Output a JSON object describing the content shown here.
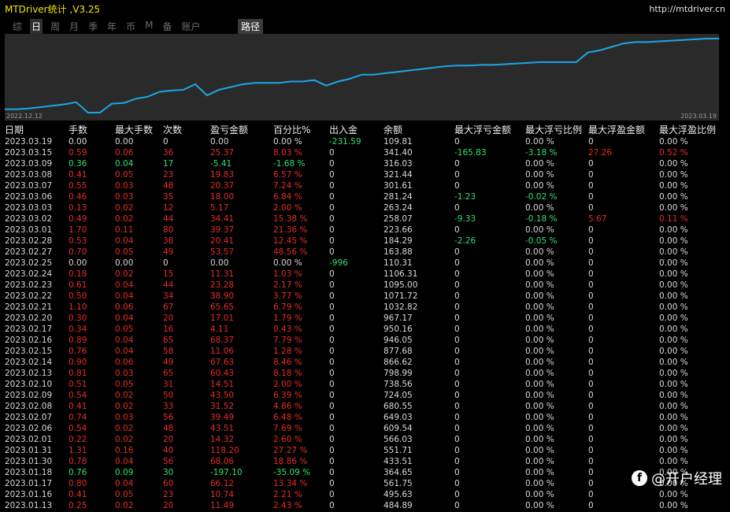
{
  "header": {
    "title": "MTDriver统计 ,V3.25",
    "url": "http://mtdriver.cn"
  },
  "toolbar": {
    "tabs": [
      "综",
      "日",
      "周",
      "月",
      "季",
      "年",
      "币",
      "M",
      "备",
      "账户"
    ],
    "active_index": 1,
    "path_label": "路径"
  },
  "chart_data": {
    "type": "line",
    "x_start_label": "2022.12.12",
    "x_end_label": "2023.03.19",
    "color": "#1aa7e6",
    "values": [
      0.0,
      0.0,
      0.01,
      0.03,
      0.05,
      0.07,
      0.1,
      -0.05,
      -0.05,
      0.08,
      0.09,
      0.15,
      0.18,
      0.25,
      0.27,
      0.28,
      0.36,
      0.2,
      0.28,
      0.32,
      0.36,
      0.38,
      0.38,
      0.38,
      0.4,
      0.4,
      0.42,
      0.34,
      0.4,
      0.44,
      0.5,
      0.5,
      0.52,
      0.54,
      0.56,
      0.58,
      0.6,
      0.62,
      0.63,
      0.63,
      0.64,
      0.64,
      0.65,
      0.66,
      0.67,
      0.68,
      0.68,
      0.68,
      0.68,
      0.82,
      0.85,
      0.9,
      0.95,
      0.97,
      0.97,
      0.98,
      0.99,
      1.0,
      1.01,
      1.02,
      1.02
    ]
  },
  "table": {
    "headers": [
      "日期",
      "手数",
      "最大手数",
      "次数",
      "盈亏金额",
      "百分比%",
      "出入金",
      "余额",
      "最大浮亏金额",
      "最大浮亏比例",
      "最大浮盈金额",
      "最大浮盈比例"
    ],
    "rows": [
      {
        "c": [
          "2023.03.19",
          "0.00",
          "0.00",
          "0",
          "0.00",
          "0.00 %",
          "-231.59",
          "109.81",
          "0",
          "0.00 %",
          "0",
          "0.00 %"
        ],
        "k": [
          "d",
          "n",
          "n",
          "n",
          "n",
          "n",
          "g",
          "n",
          "n",
          "n",
          "n",
          "n"
        ]
      },
      {
        "c": [
          "2023.03.15",
          "0.59",
          "0.06",
          "36",
          "25.37",
          "8.03 %",
          "0",
          "341.40",
          "-165.83",
          "-3.18 %",
          "27.26",
          "0.52 %"
        ],
        "k": [
          "d",
          "r",
          "r",
          "r",
          "r",
          "r",
          "n",
          "n",
          "g",
          "g",
          "r",
          "r"
        ]
      },
      {
        "c": [
          "2023.03.09",
          "0.36",
          "0.04",
          "17",
          "-5.41",
          "-1.68 %",
          "0",
          "316.03",
          "0",
          "0.00 %",
          "0",
          "0.00 %"
        ],
        "k": [
          "d",
          "g",
          "g",
          "g",
          "g",
          "g",
          "n",
          "n",
          "n",
          "n",
          "n",
          "n"
        ]
      },
      {
        "c": [
          "2023.03.08",
          "0.41",
          "0.05",
          "23",
          "19.83",
          "6.57 %",
          "0",
          "321.44",
          "0",
          "0.00 %",
          "0",
          "0.00 %"
        ],
        "k": [
          "d",
          "r",
          "r",
          "r",
          "r",
          "r",
          "n",
          "n",
          "n",
          "n",
          "n",
          "n"
        ]
      },
      {
        "c": [
          "2023.03.07",
          "0.55",
          "0.03",
          "48",
          "20.37",
          "7.24 %",
          "0",
          "301.61",
          "0",
          "0.00 %",
          "0",
          "0.00 %"
        ],
        "k": [
          "d",
          "r",
          "r",
          "r",
          "r",
          "r",
          "n",
          "n",
          "n",
          "n",
          "n",
          "n"
        ]
      },
      {
        "c": [
          "2023.03.06",
          "0.46",
          "0.03",
          "35",
          "18.00",
          "6.84 %",
          "0",
          "281.24",
          "-1.23",
          "-0.02 %",
          "0",
          "0.00 %"
        ],
        "k": [
          "d",
          "r",
          "r",
          "r",
          "r",
          "r",
          "n",
          "n",
          "g",
          "g",
          "n",
          "n"
        ]
      },
      {
        "c": [
          "2023.03.03",
          "0.13",
          "0.02",
          "12",
          "5.17",
          "2.00 %",
          "0",
          "263.24",
          "0",
          "0.00 %",
          "0",
          "0.00 %"
        ],
        "k": [
          "d",
          "r",
          "r",
          "r",
          "r",
          "r",
          "n",
          "n",
          "n",
          "n",
          "n",
          "n"
        ]
      },
      {
        "c": [
          "2023.03.02",
          "0.49",
          "0.02",
          "44",
          "34.41",
          "15.38 %",
          "0",
          "258.07",
          "-9.33",
          "-0.18 %",
          "5.67",
          "0.11 %"
        ],
        "k": [
          "d",
          "r",
          "r",
          "r",
          "r",
          "r",
          "n",
          "n",
          "g",
          "g",
          "r",
          "r"
        ]
      },
      {
        "c": [
          "2023.03.01",
          "1.70",
          "0.11",
          "80",
          "39.37",
          "21.36 %",
          "0",
          "223.66",
          "0",
          "0.00 %",
          "0",
          "0.00 %"
        ],
        "k": [
          "d",
          "r",
          "r",
          "r",
          "r",
          "r",
          "n",
          "n",
          "n",
          "n",
          "n",
          "n"
        ]
      },
      {
        "c": [
          "2023.02.28",
          "0.53",
          "0.04",
          "38",
          "20.41",
          "12.45 %",
          "0",
          "184.29",
          "-2.26",
          "-0.05 %",
          "0",
          "0.00 %"
        ],
        "k": [
          "d",
          "r",
          "r",
          "r",
          "r",
          "r",
          "n",
          "n",
          "g",
          "g",
          "n",
          "n"
        ]
      },
      {
        "c": [
          "2023.02.27",
          "0.70",
          "0.05",
          "49",
          "53.57",
          "48.56 %",
          "0",
          "163.88",
          "0",
          "0.00 %",
          "0",
          "0.00 %"
        ],
        "k": [
          "d",
          "r",
          "r",
          "r",
          "r",
          "r",
          "n",
          "n",
          "n",
          "n",
          "n",
          "n"
        ]
      },
      {
        "c": [
          "2023.02.25",
          "0.00",
          "0.00",
          "0",
          "0.00",
          "0.00 %",
          "-996",
          "110.31",
          "0",
          "0.00 %",
          "0",
          "0.00 %"
        ],
        "k": [
          "d",
          "n",
          "n",
          "n",
          "n",
          "n",
          "g",
          "n",
          "n",
          "n",
          "n",
          "n"
        ]
      },
      {
        "c": [
          "2023.02.24",
          "0.18",
          "0.02",
          "15",
          "11.31",
          "1.03 %",
          "0",
          "1106.31",
          "0",
          "0.00 %",
          "0",
          "0.00 %"
        ],
        "k": [
          "d",
          "r",
          "r",
          "r",
          "r",
          "r",
          "n",
          "n",
          "n",
          "n",
          "n",
          "n"
        ]
      },
      {
        "c": [
          "2023.02.23",
          "0.61",
          "0.04",
          "44",
          "23.28",
          "2.17 %",
          "0",
          "1095.00",
          "0",
          "0.00 %",
          "0",
          "0.00 %"
        ],
        "k": [
          "d",
          "r",
          "r",
          "r",
          "r",
          "r",
          "n",
          "n",
          "n",
          "n",
          "n",
          "n"
        ]
      },
      {
        "c": [
          "2023.02.22",
          "0.50",
          "0.04",
          "34",
          "38.90",
          "3.77 %",
          "0",
          "1071.72",
          "0",
          "0.00 %",
          "0",
          "0.00 %"
        ],
        "k": [
          "d",
          "r",
          "r",
          "r",
          "r",
          "r",
          "n",
          "n",
          "n",
          "n",
          "n",
          "n"
        ]
      },
      {
        "c": [
          "2023.02.21",
          "1.10",
          "0.06",
          "67",
          "65.65",
          "6.79 %",
          "0",
          "1032.82",
          "0",
          "0.00 %",
          "0",
          "0.00 %"
        ],
        "k": [
          "d",
          "r",
          "r",
          "r",
          "r",
          "r",
          "n",
          "n",
          "n",
          "n",
          "n",
          "n"
        ]
      },
      {
        "c": [
          "2023.02.20",
          "0.30",
          "0.04",
          "20",
          "17.01",
          "1.79 %",
          "0",
          "967.17",
          "0",
          "0.00 %",
          "0",
          "0.00 %"
        ],
        "k": [
          "d",
          "r",
          "r",
          "r",
          "r",
          "r",
          "n",
          "n",
          "n",
          "n",
          "n",
          "n"
        ]
      },
      {
        "c": [
          "2023.02.17",
          "0.34",
          "0.05",
          "16",
          "4.11",
          "0.43 %",
          "0",
          "950.16",
          "0",
          "0.00 %",
          "0",
          "0.00 %"
        ],
        "k": [
          "d",
          "r",
          "r",
          "r",
          "r",
          "r",
          "n",
          "n",
          "n",
          "n",
          "n",
          "n"
        ]
      },
      {
        "c": [
          "2023.02.16",
          "0.89",
          "0.04",
          "65",
          "68.37",
          "7.79 %",
          "0",
          "946.05",
          "0",
          "0.00 %",
          "0",
          "0.00 %"
        ],
        "k": [
          "d",
          "r",
          "r",
          "r",
          "r",
          "r",
          "n",
          "n",
          "n",
          "n",
          "n",
          "n"
        ]
      },
      {
        "c": [
          "2023.02.15",
          "0.76",
          "0.04",
          "58",
          "11.06",
          "1.28 %",
          "0",
          "877.68",
          "0",
          "0.00 %",
          "0",
          "0.00 %"
        ],
        "k": [
          "d",
          "r",
          "r",
          "r",
          "r",
          "r",
          "n",
          "n",
          "n",
          "n",
          "n",
          "n"
        ]
      },
      {
        "c": [
          "2023.02.14",
          "0.90",
          "0.06",
          "49",
          "67.63",
          "8.46 %",
          "0",
          "866.62",
          "0",
          "0.00 %",
          "0",
          "0.00 %"
        ],
        "k": [
          "d",
          "r",
          "r",
          "r",
          "r",
          "r",
          "n",
          "n",
          "n",
          "n",
          "n",
          "n"
        ]
      },
      {
        "c": [
          "2023.02.13",
          "0.81",
          "0.03",
          "65",
          "60.43",
          "8.18 %",
          "0",
          "798.99",
          "0",
          "0.00 %",
          "0",
          "0.00 %"
        ],
        "k": [
          "d",
          "r",
          "r",
          "r",
          "r",
          "r",
          "n",
          "n",
          "n",
          "n",
          "n",
          "n"
        ]
      },
      {
        "c": [
          "2023.02.10",
          "0.51",
          "0.05",
          "31",
          "14.51",
          "2.00 %",
          "0",
          "738.56",
          "0",
          "0.00 %",
          "0",
          "0.00 %"
        ],
        "k": [
          "d",
          "r",
          "r",
          "r",
          "r",
          "r",
          "n",
          "n",
          "n",
          "n",
          "n",
          "n"
        ]
      },
      {
        "c": [
          "2023.02.09",
          "0.54",
          "0.02",
          "50",
          "43.50",
          "6.39 %",
          "0",
          "724.05",
          "0",
          "0.00 %",
          "0",
          "0.00 %"
        ],
        "k": [
          "d",
          "r",
          "r",
          "r",
          "r",
          "r",
          "n",
          "n",
          "n",
          "n",
          "n",
          "n"
        ]
      },
      {
        "c": [
          "2023.02.08",
          "0.41",
          "0.02",
          "33",
          "31.52",
          "4.86 %",
          "0",
          "680.55",
          "0",
          "0.00 %",
          "0",
          "0.00 %"
        ],
        "k": [
          "d",
          "r",
          "r",
          "r",
          "r",
          "r",
          "n",
          "n",
          "n",
          "n",
          "n",
          "n"
        ]
      },
      {
        "c": [
          "2023.02.07",
          "0.74",
          "0.03",
          "56",
          "39.49",
          "6.48 %",
          "0",
          "649.03",
          "0",
          "0.00 %",
          "0",
          "0.00 %"
        ],
        "k": [
          "d",
          "r",
          "r",
          "r",
          "r",
          "r",
          "n",
          "n",
          "n",
          "n",
          "n",
          "n"
        ]
      },
      {
        "c": [
          "2023.02.06",
          "0.54",
          "0.02",
          "48",
          "43.51",
          "7.69 %",
          "0",
          "609.54",
          "0",
          "0.00 %",
          "0",
          "0.00 %"
        ],
        "k": [
          "d",
          "r",
          "r",
          "r",
          "r",
          "r",
          "n",
          "n",
          "n",
          "n",
          "n",
          "n"
        ]
      },
      {
        "c": [
          "2023.02.01",
          "0.22",
          "0.02",
          "20",
          "14.32",
          "2.60 %",
          "0",
          "566.03",
          "0",
          "0.00 %",
          "0",
          "0.00 %"
        ],
        "k": [
          "d",
          "r",
          "r",
          "r",
          "r",
          "r",
          "n",
          "n",
          "n",
          "n",
          "n",
          "n"
        ]
      },
      {
        "c": [
          "2023.01.31",
          "1.31",
          "0.16",
          "40",
          "118.20",
          "27.27 %",
          "0",
          "551.71",
          "0",
          "0.00 %",
          "0",
          "0.00 %"
        ],
        "k": [
          "d",
          "r",
          "r",
          "r",
          "r",
          "r",
          "n",
          "n",
          "n",
          "n",
          "n",
          "n"
        ]
      },
      {
        "c": [
          "2023.01.30",
          "0.78",
          "0.04",
          "56",
          "68.06",
          "18.86 %",
          "0",
          "433.51",
          "0",
          "0.00 %",
          "0",
          "0.00 %"
        ],
        "k": [
          "d",
          "r",
          "r",
          "r",
          "r",
          "r",
          "n",
          "n",
          "n",
          "n",
          "n",
          "n"
        ]
      },
      {
        "c": [
          "2023.01.18",
          "0.76",
          "0.09",
          "30",
          "-197.10",
          "-35.09 %",
          "0",
          "364.65",
          "0",
          "0.00 %",
          "0",
          "0.00 %"
        ],
        "k": [
          "d",
          "g",
          "g",
          "g",
          "g",
          "g",
          "n",
          "n",
          "n",
          "n",
          "n",
          "n"
        ]
      },
      {
        "c": [
          "2023.01.17",
          "0.80",
          "0.04",
          "60",
          "66.12",
          "13.34 %",
          "0",
          "561.75",
          "0",
          "0.00 %",
          "0",
          "0.00 %"
        ],
        "k": [
          "d",
          "r",
          "r",
          "r",
          "r",
          "r",
          "n",
          "n",
          "n",
          "n",
          "n",
          "n"
        ]
      },
      {
        "c": [
          "2023.01.16",
          "0.41",
          "0.05",
          "23",
          "10.74",
          "2.21 %",
          "0",
          "495.63",
          "0",
          "0.00 %",
          "0",
          "0.00 %"
        ],
        "k": [
          "d",
          "r",
          "r",
          "r",
          "r",
          "r",
          "n",
          "n",
          "n",
          "n",
          "n",
          "n"
        ]
      },
      {
        "c": [
          "2023.01.13",
          "0.25",
          "0.02",
          "20",
          "11.49",
          "2.43 %",
          "0",
          "484.89",
          "0",
          "0.00 %",
          "0",
          "0.00 %"
        ],
        "k": [
          "d",
          "r",
          "r",
          "r",
          "r",
          "r",
          "n",
          "n",
          "n",
          "n",
          "n",
          "n"
        ]
      }
    ]
  },
  "watermark": {
    "text": "@开户经理",
    "icon_letter": "f"
  }
}
